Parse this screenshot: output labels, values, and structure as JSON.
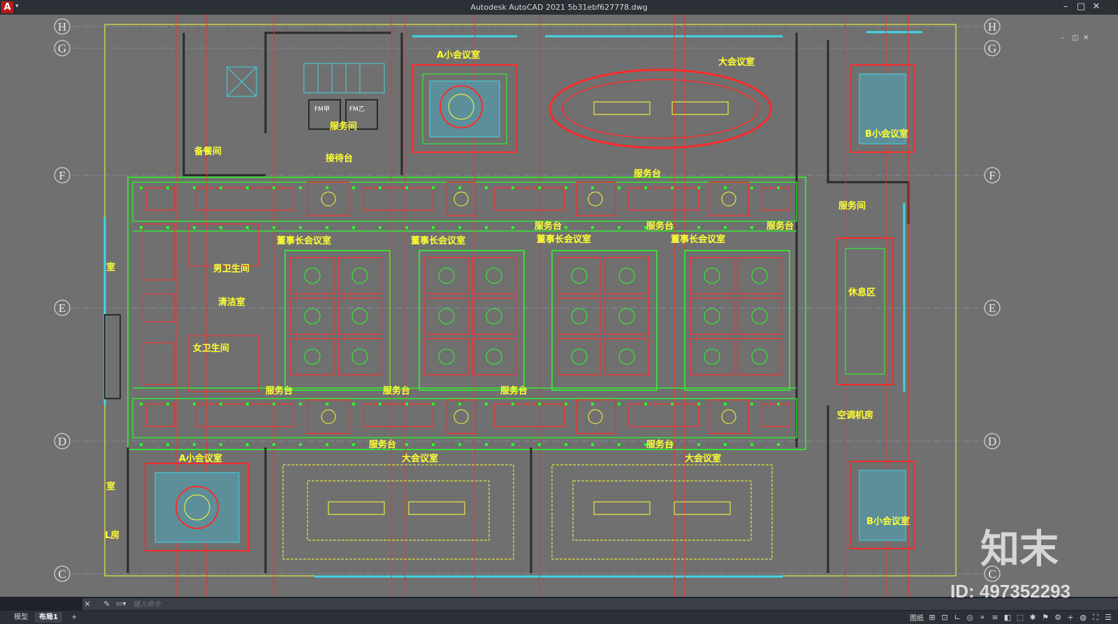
{
  "window": {
    "app_logo": "A",
    "title": "Autodesk AutoCAD 2021    5b31ebf627778.dwg",
    "controls": [
      "–",
      "□",
      "✕"
    ],
    "doc_controls": [
      "–",
      "◫",
      "✕"
    ]
  },
  "grid_axes": {
    "rows": [
      "H",
      "G",
      "F",
      "E",
      "D",
      "C"
    ]
  },
  "rooms": {
    "a_small_meeting_top": "A小会议室",
    "large_meeting_top": "大会议室",
    "service_room_top": "服务间",
    "reception": "接待台",
    "serving_room_left": "备餐间",
    "service_desk": "服务台",
    "b_small_meeting_top": "B小会议室",
    "service_room_right": "服务间",
    "board_room": "董事长会议室",
    "restroom_1": "男卫生间",
    "cleaning": "清洁室",
    "restroom_2": "女卫生间",
    "lounge": "休息区",
    "ac_room": "空调机房",
    "a_small_meeting_bottom": "A小会议室",
    "large_meeting_bottom": "大会议室",
    "b_small_meeting_bottom": "B小会议室",
    "room_short": "室",
    "room_left": "L房",
    "elevator_1": "FM甲",
    "elevator_2": "FM乙"
  },
  "command_line": {
    "placeholder": "键入命令"
  },
  "layout_tabs": [
    "模型",
    "布局1",
    "+"
  ],
  "status": {
    "label": "图纸",
    "icons": [
      "grid-icon",
      "snap-icon",
      "ortho-icon",
      "polar-icon",
      "osnap-icon",
      "lineweight-icon",
      "transparency-icon",
      "selection-icon",
      "annotation-icon",
      "workspace-icon",
      "gear-icon",
      "plus-icon",
      "isolate-icon",
      "fullscreen-icon",
      "menu-icon"
    ]
  },
  "watermark": {
    "brand": "知末",
    "id": "ID: 497352293"
  },
  "colors": {
    "background": "#707070",
    "wall_red": "#ff2a2a",
    "dim_green": "#28ff28",
    "text_yellow": "#ffff33",
    "hatch_cyan": "#3fd6e6"
  }
}
